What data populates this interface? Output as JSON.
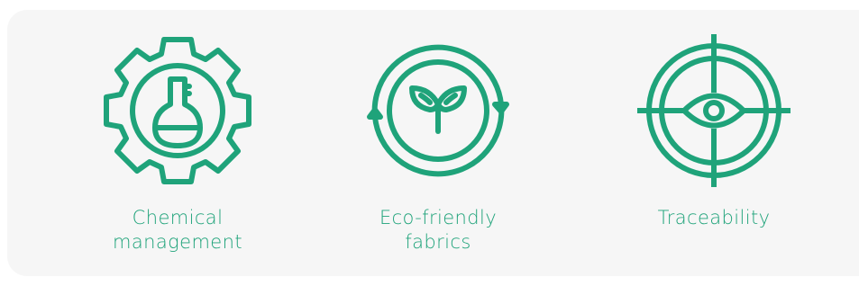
{
  "accent_color": "#1fa37a",
  "panel_color": "#f6f6f6",
  "features": [
    {
      "icon": "gear-flask-icon",
      "label_line1": "Chemical",
      "label_line2": "management"
    },
    {
      "icon": "recycle-sprout-icon",
      "label_line1": "Eco-friendly",
      "label_line2": "fabrics"
    },
    {
      "icon": "target-eye-icon",
      "label_line1": "Traceability",
      "label_line2": ""
    }
  ]
}
